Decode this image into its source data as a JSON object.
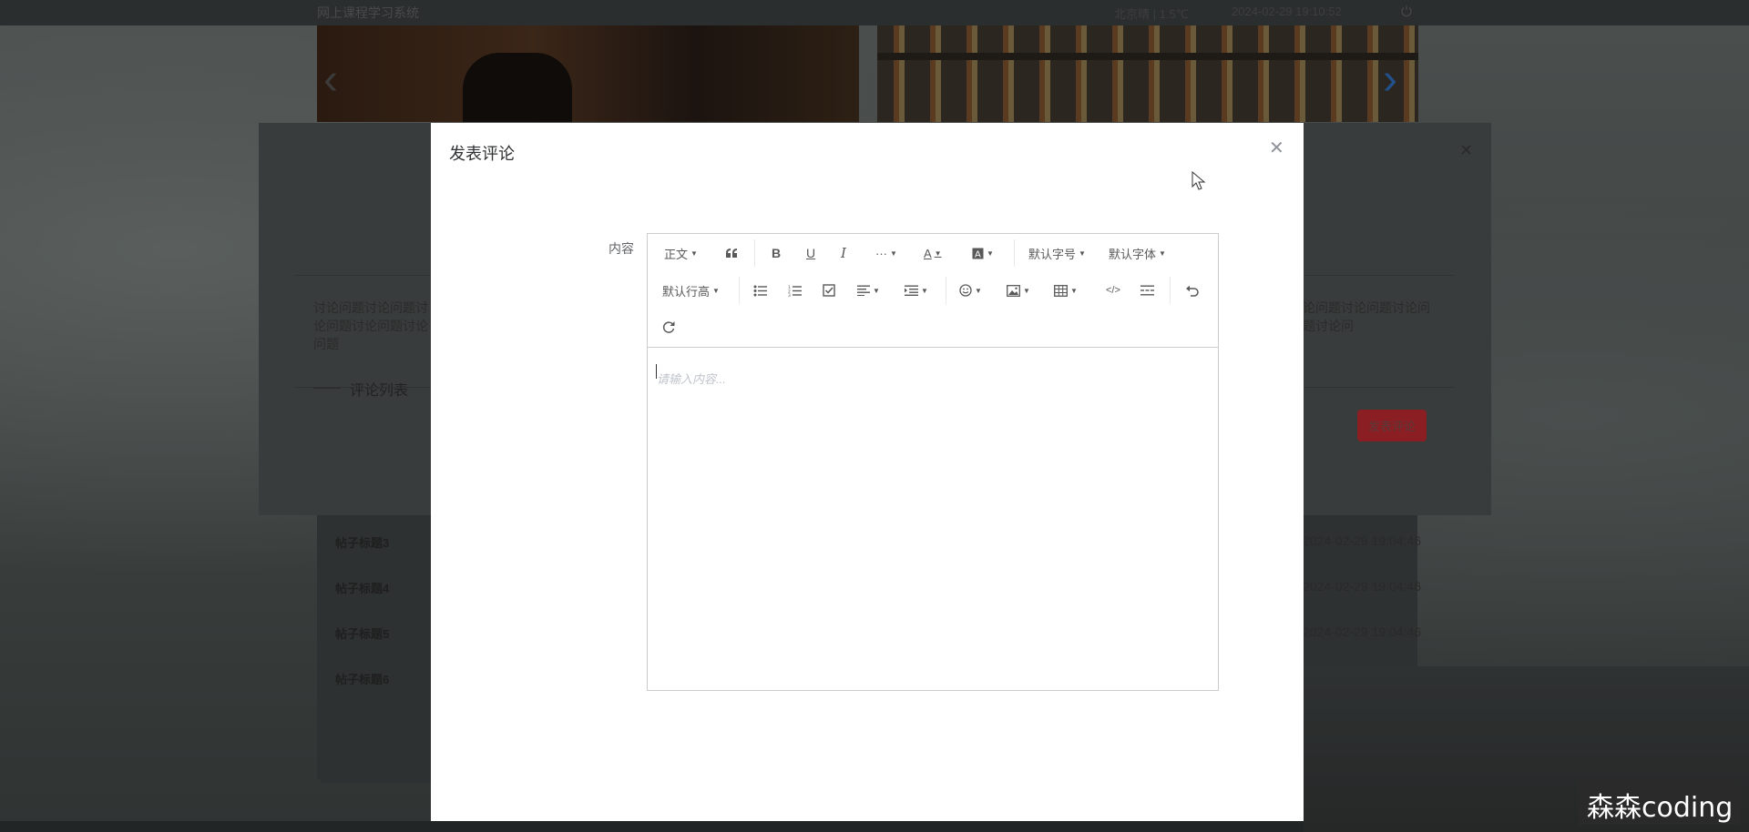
{
  "topbar": {
    "site_title": "网上课程学习系统",
    "weather": "北京晴 | 1.5℃",
    "datetime": "2024-02-29  19:10:52"
  },
  "posts": [
    {
      "title": "帖子标题3",
      "time": "2024-02-29 19:04:46"
    },
    {
      "title": "帖子标题4",
      "time": "2024-02-29 19:04:46"
    },
    {
      "title": "帖子标题5",
      "time": "2024-02-29 19:04:46"
    },
    {
      "title": "帖子标题6",
      "time": ""
    }
  ],
  "background_dialog": {
    "body_left": "讨论问题讨论问题讨论问题讨论问题讨论问题",
    "body_right": "论问题讨论问题讨论问题讨论问",
    "comment_list_title": "评论列表",
    "post_comment_label": "发表评论"
  },
  "dialog": {
    "title": "发表评论",
    "field_label": "内容",
    "placeholder": "请输入内容..."
  },
  "toolbar": {
    "paragraph": "正文",
    "font_size": "默认字号",
    "font_family": "默认字体",
    "line_height": "默认行高"
  },
  "watermark": "森森coding",
  "colors": {
    "primary_button": "#8a1e23",
    "overlay": "#393c3c"
  }
}
